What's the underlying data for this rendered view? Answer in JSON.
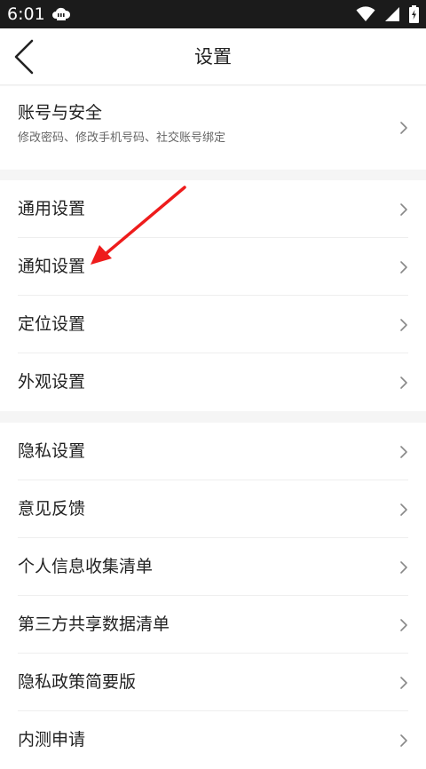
{
  "status_bar": {
    "time": "6:01",
    "icons": [
      "cloud-notification-icon",
      "wifi-icon",
      "signal-icon",
      "battery-charging-icon"
    ]
  },
  "header": {
    "title": "设置",
    "back_icon": "chevron-left-icon"
  },
  "account": {
    "label": "账号与安全",
    "subtitle": "修改密码、修改手机号码、社交账号绑定"
  },
  "group1": {
    "items": [
      {
        "label": "通用设置"
      },
      {
        "label": "通知设置"
      },
      {
        "label": "定位设置"
      },
      {
        "label": "外观设置"
      }
    ]
  },
  "group2": {
    "items": [
      {
        "label": "隐私设置"
      },
      {
        "label": "意见反馈"
      },
      {
        "label": "个人信息收集清单"
      },
      {
        "label": "第三方共享数据清单"
      },
      {
        "label": "隐私政策简要版"
      },
      {
        "label": "内测申请"
      }
    ]
  },
  "annotation": {
    "type": "red-arrow",
    "color": "#ee1c1c",
    "points_to": "通知设置"
  },
  "colors": {
    "status_bar": "#1b1b1b",
    "background": "#f5f5f5",
    "surface": "#ffffff",
    "text": "#222222",
    "subtext": "#666666",
    "chevron": "#888888"
  }
}
